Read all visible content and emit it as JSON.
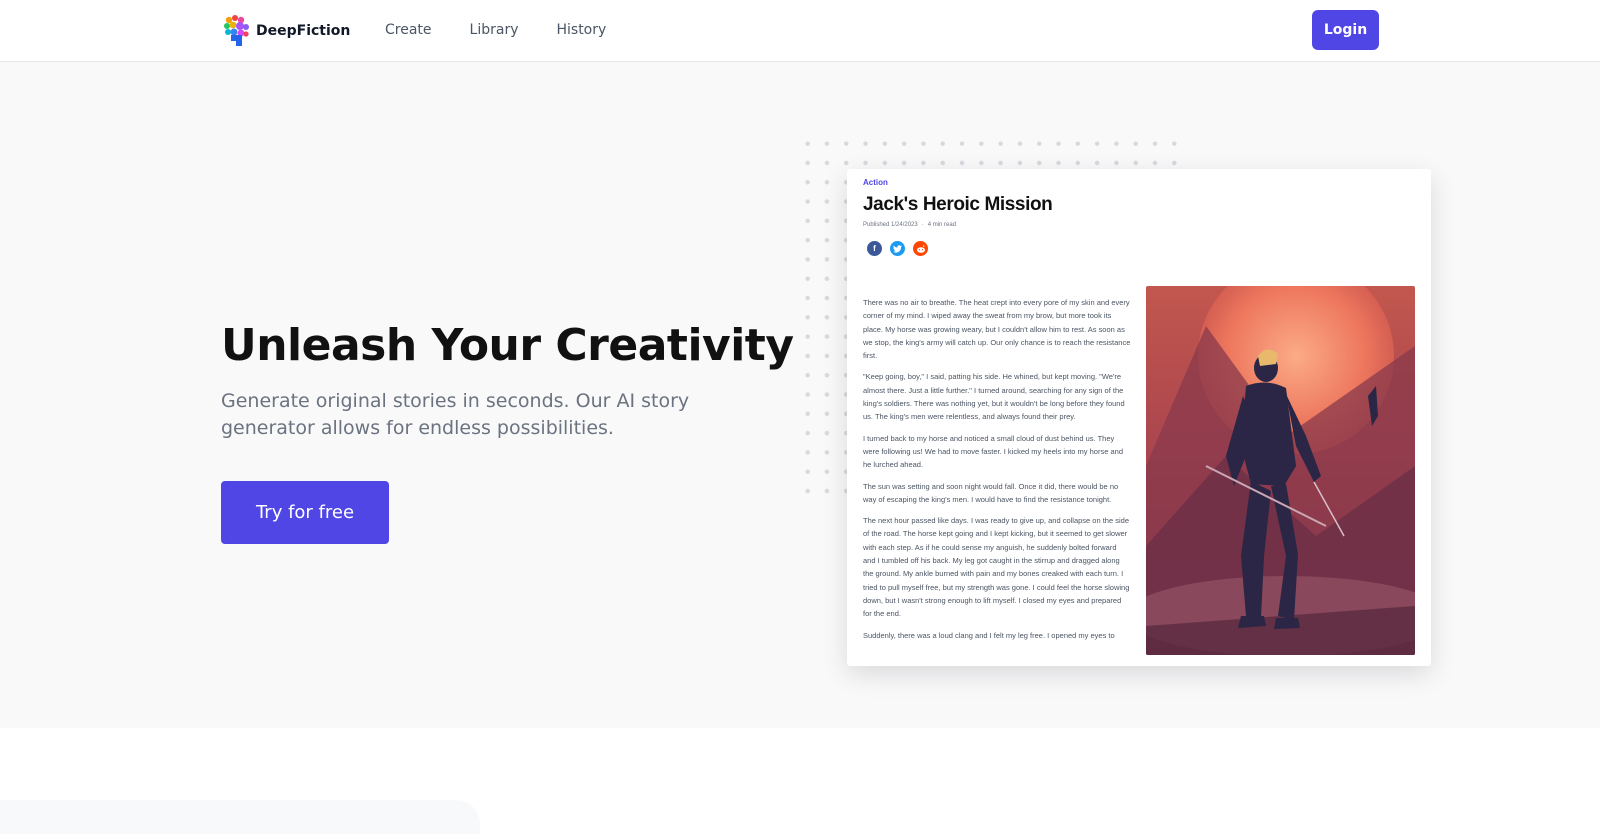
{
  "header": {
    "brand": "DeepFiction",
    "nav": [
      {
        "label": "Create"
      },
      {
        "label": "Library"
      },
      {
        "label": "History"
      }
    ],
    "login_label": "Login"
  },
  "hero": {
    "headline": "Unleash Your Creativity",
    "subtext": "Generate original stories in seconds. Our AI story generator allows for endless possibilities.",
    "cta_label": "Try for free"
  },
  "story": {
    "genre": "Action",
    "title": "Jack's Heroic Mission",
    "published": "Published 1/24/2023",
    "separator": "·",
    "read_time": "4 min read",
    "share_icons": [
      "facebook-icon",
      "twitter-icon",
      "reddit-icon"
    ],
    "paragraphs": [
      "There was no air to breathe. The heat crept into every pore of my skin and every corner of my mind. I wiped away the sweat from my brow, but more took its place. My horse was growing weary, but I couldn't allow him to rest. As soon as we stop, the king's army will catch up. Our only chance is to reach the resistance first.",
      "\"Keep going, boy,\" I said, patting his side. He whined, but kept moving. \"We're almost there. Just a little further.\" I turned around, searching for any sign of the king's soldiers. There was nothing yet, but it wouldn't be long before they found us. The king's men were relentless, and always found their prey.",
      "I turned back to my horse and noticed a small cloud of dust behind us. They were following us! We had to move faster. I kicked my heels into my horse and he lurched ahead.",
      "The sun was setting and soon night would fall. Once it did, there would be no way of escaping the king's men. I would have to find the resistance tonight.",
      "The next hour passed like days. I was ready to give up, and collapse on the side of the road. The horse kept going and I kept kicking, but it seemed to get slower with each step. As if he could sense my anguish, he suddenly bolted forward and I tumbled off his back. My leg got caught in the stirrup and dragged along the ground. My ankle burned with pain and my bones creaked with each turn. I tried to pull myself free, but my strength was gone. I could feel the horse slowing down, but I wasn't strong enough to lift myself. I closed my eyes and prepared for the end.",
      "Suddenly, there was a loud clang and I felt my leg free. I opened my eyes to"
    ]
  },
  "colors": {
    "accent": "#4f46e5",
    "hero_bg": "#f9f9fa",
    "facebook": "#3b5998",
    "twitter": "#1d9bf0",
    "reddit": "#ff4500"
  }
}
